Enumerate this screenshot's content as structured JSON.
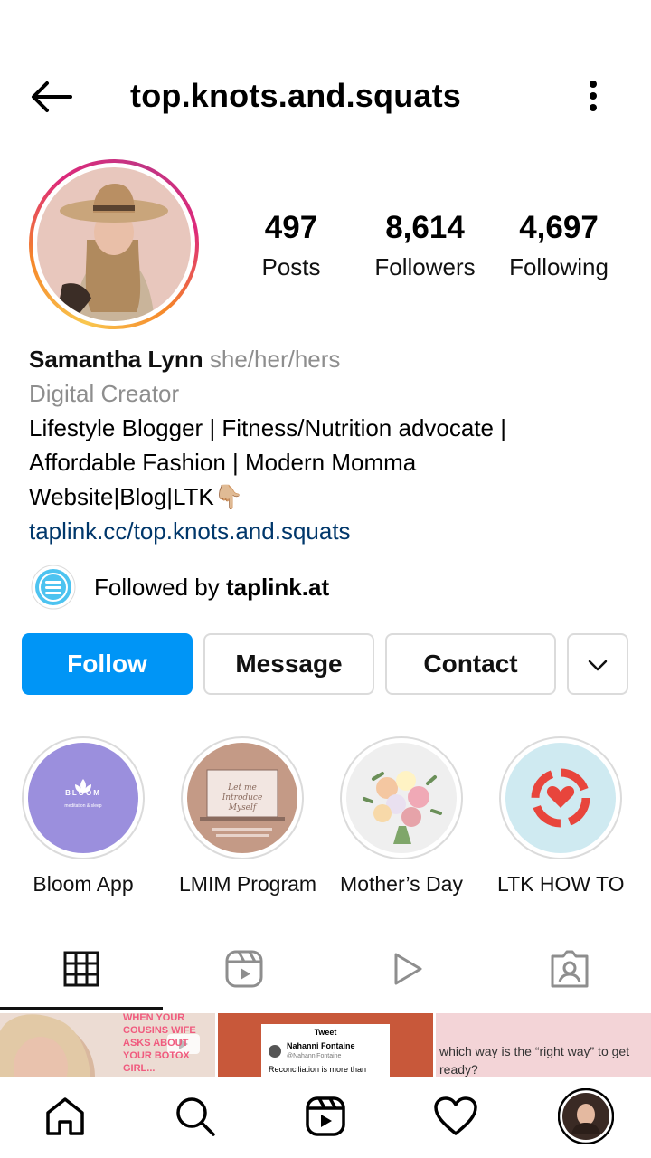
{
  "header": {
    "username": "top.knots.and.squats"
  },
  "stats": [
    {
      "value": "497",
      "label": "Posts"
    },
    {
      "value": "8,614",
      "label": "Followers"
    },
    {
      "value": "4,697",
      "label": "Following"
    }
  ],
  "bio": {
    "name": "Samantha Lynn",
    "pronouns": "she/her/hers",
    "category": "Digital Creator",
    "lines": [
      "Lifestyle Blogger | Fitness/Nutrition advocate |",
      "Affordable Fashion | Modern Momma",
      "Website|Blog|LTK👇🏼"
    ],
    "link": "taplink.cc/top.knots.and.squats"
  },
  "followed_by": {
    "prefix": "Followed by ",
    "account": "taplink.at"
  },
  "actions": {
    "follow": "Follow",
    "message": "Message",
    "contact": "Contact"
  },
  "highlights": [
    {
      "label": "Bloom App",
      "title": "BLOOM",
      "subtitle": "meditation & sleep"
    },
    {
      "label": "LMIM Program",
      "title": "Let me Introduce Myself"
    },
    {
      "label": "Mother’s Day"
    },
    {
      "label": "LTK HOW TO"
    }
  ],
  "posts": [
    {
      "caption": "WHEN YOUR COUSINS WIFE ASKS ABOUT YOUR BOTOX GIRL..."
    },
    {
      "tweet_heading": "Tweet",
      "tweet_name": "Nahanni Fontaine",
      "tweet_handle": "@NahanniFontaine",
      "tweet_text": "Reconciliation is more than"
    },
    {
      "caption": "which way is the “right way” to get ready?"
    }
  ],
  "colors": {
    "accent": "#0095f6",
    "link": "#00376b",
    "muted": "#8e8e8e",
    "border": "#dbdbdb"
  }
}
